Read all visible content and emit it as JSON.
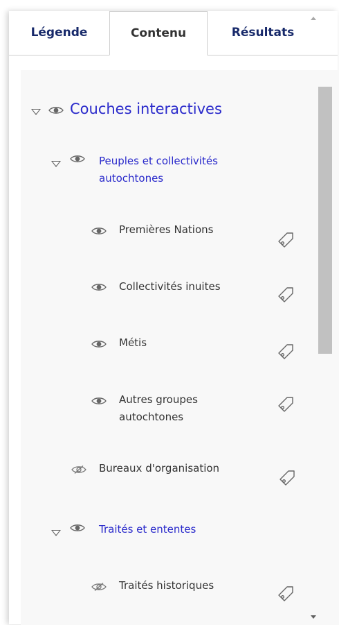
{
  "tabs": [
    {
      "label": "Légende",
      "active": false
    },
    {
      "label": "Contenu",
      "active": true
    },
    {
      "label": "Résultats",
      "active": false
    }
  ],
  "tree": {
    "root": {
      "label": "Couches interactives",
      "expanded": true,
      "visibility_icon": "eye-icon"
    },
    "group1": {
      "label_line1": "Peuples et collectivités",
      "label_line2": "autochtones",
      "expanded": true,
      "visibility_icon": "eye-icon"
    },
    "layers": [
      {
        "label": "Premières Nations",
        "visibility_icon": "eye-icon"
      },
      {
        "label": "Collectivités inuites",
        "visibility_icon": "eye-icon"
      },
      {
        "label": "Métis",
        "visibility_icon": "eye-icon"
      },
      {
        "label_line1": "Autres groupes",
        "label_line2": "autochtones",
        "visibility_icon": "eye-icon"
      },
      {
        "label": "Bureaux d'organisation",
        "visibility_icon": "eye-off-icon"
      }
    ],
    "group2": {
      "label": "Traités et ententes",
      "expanded": true,
      "visibility_icon": "eye-icon"
    },
    "group2_layers": [
      {
        "label": "Traités historiques",
        "visibility_icon": "eye-off-icon"
      }
    ]
  },
  "colors": {
    "tab_text": "#17296a",
    "active_tab_text": "#333333",
    "group_link": "#2a2acb",
    "item_text": "#333333",
    "icon": "#666666",
    "panel_bg": "#f8f8f8",
    "scroll_thumb": "#c1c1c1"
  }
}
